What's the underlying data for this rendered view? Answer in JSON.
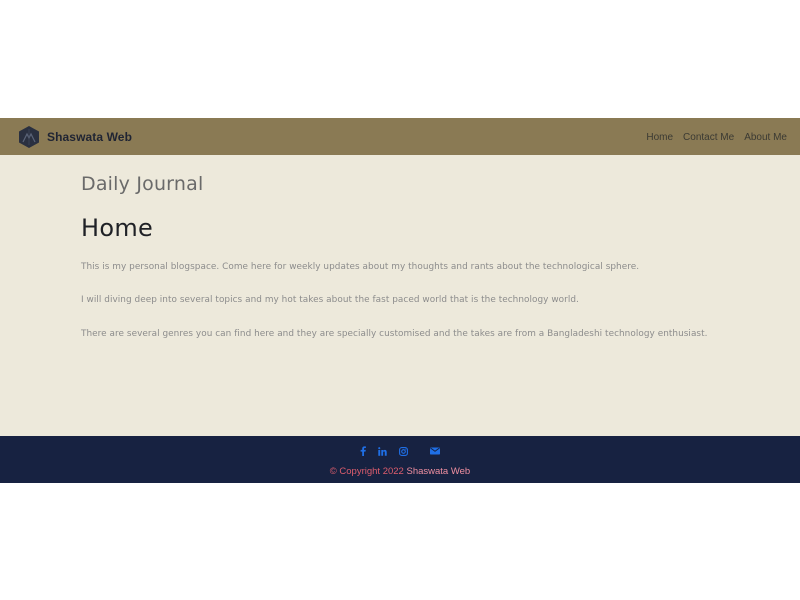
{
  "navbar": {
    "brand": "Shaswata Web",
    "links": [
      "Home",
      "Contact Me",
      "About Me"
    ],
    "background": "#8a7a54"
  },
  "main": {
    "site_title": "Daily Journal",
    "heading": "Home",
    "paragraphs": [
      "This is my personal blogspace. Come here for weekly updates about my thoughts and rants about the technological sphere.",
      "I will diving deep into several topics and my hot takes about the fast paced world that is the technology world.",
      "There are several genres you can find here and they are specially customised and the takes are from a Bangladeshi technology enthusiast."
    ],
    "background": "#ede9db"
  },
  "footer": {
    "social_icons": [
      "facebook-icon",
      "linkedin-icon",
      "instagram-icon",
      "envelope-icon"
    ],
    "copyright_prefix": "© Copyright 2022",
    "copyright_name": "Shaswata Web",
    "background": "#172241",
    "icon_color": "#1f6fe6"
  }
}
